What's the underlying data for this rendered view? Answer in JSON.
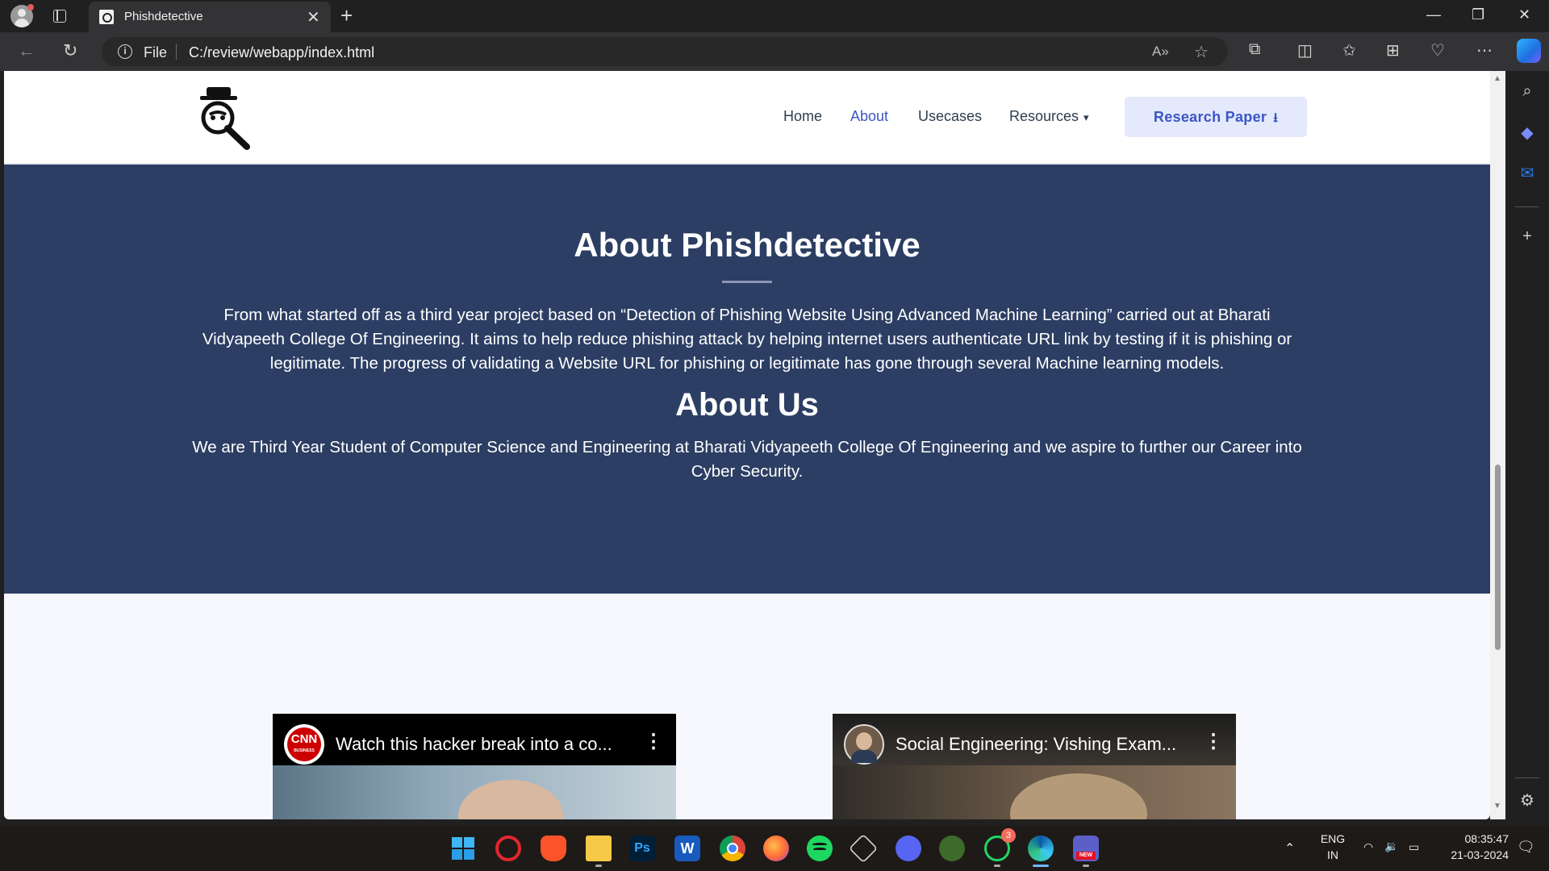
{
  "browser": {
    "tab_title": "Phishdetective",
    "address_scheme": "File",
    "address_url": "C:/review/webapp/index.html"
  },
  "site": {
    "nav": {
      "home": "Home",
      "about": "About",
      "usecases": "Usecases",
      "resources": "Resources",
      "research_paper": "Research Paper"
    },
    "about_title": "About Phishdetective",
    "about_text": "From what started off as a third year project based on “Detection of Phishing Website Using Advanced Machine Learning” carried out at Bharati Vidyapeeth College Of Engineering. It aims to help reduce phishing attack by helping internet users authenticate URL link by testing if it is phishing or legitimate. The progress of validating a Website URL for phishing or legitimate has gone through several Machine learning models.",
    "about_us_title": "About Us",
    "about_us_text": "We are Third Year Student of Computer Science and Engineering at Bharati Vidyapeeth College Of Engineering and we aspire to further our Career into Cyber Security.",
    "videos": [
      {
        "title": "Watch this hacker break into a co...",
        "channel_label": "CNN",
        "channel_sub": "BUSINESS"
      },
      {
        "title": "Social Engineering: Vishing Exam..."
      }
    ]
  },
  "taskbar": {
    "language": "ENG",
    "region": "IN",
    "time": "08:35:47",
    "date": "21-03-2024",
    "whatsapp_badge": "3",
    "teams_badge": "NEW"
  },
  "colors": {
    "accent": "#3b55c6",
    "about_bg": "#2c3e63",
    "scroll_top_btn": "#1f6fe0"
  }
}
